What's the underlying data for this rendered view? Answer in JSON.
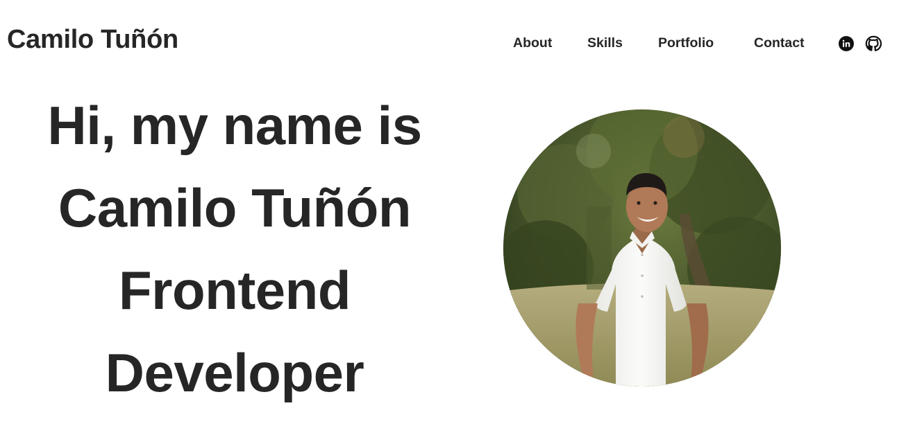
{
  "header": {
    "logo_text": "Camilo Tuñón",
    "nav": {
      "about": "About",
      "skills": "Skills",
      "portfolio": "Portfolio",
      "contact": "Contact"
    },
    "social_icons": [
      "linkedin-icon",
      "github-icon"
    ]
  },
  "hero": {
    "heading_lines": [
      "Hi, my name is",
      "Camilo Tuñón",
      "Frontend",
      "Developer"
    ],
    "photo": "profile-photo"
  },
  "colors": {
    "text": "#262626",
    "background": "#ffffff"
  }
}
